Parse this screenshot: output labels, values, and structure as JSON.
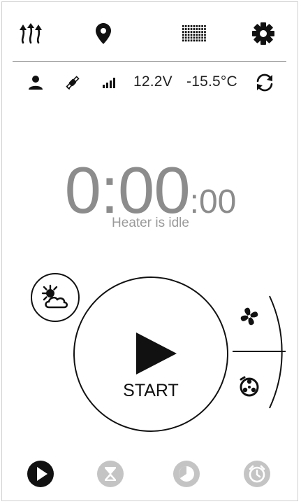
{
  "toolbar": {
    "icons": [
      "heat-arrows-icon",
      "location-pin-icon",
      "display-matrix-icon",
      "gear-icon"
    ]
  },
  "status": {
    "voltage": "12.2V",
    "temperature": "-15.5°C",
    "icons": [
      "user-icon",
      "satellite-icon",
      "signal-bars-icon",
      "refresh-icon"
    ]
  },
  "timer": {
    "main": "0:00",
    "sub": ":00",
    "state": "Heater is idle"
  },
  "controls": {
    "start_label": "START",
    "weather_icon": "sun-cloud-icon",
    "side_icons": [
      "fan-icon",
      "pump-icon"
    ]
  },
  "bottom_nav": {
    "items": [
      {
        "icon": "play-circle-icon",
        "active": true
      },
      {
        "icon": "hourglass-icon",
        "active": false
      },
      {
        "icon": "clock-icon",
        "active": false
      },
      {
        "icon": "alarm-clock-icon",
        "active": false
      }
    ]
  },
  "colors": {
    "active": "#111111",
    "inactive": "#c4c4c4",
    "timer": "#8c8c8c"
  }
}
